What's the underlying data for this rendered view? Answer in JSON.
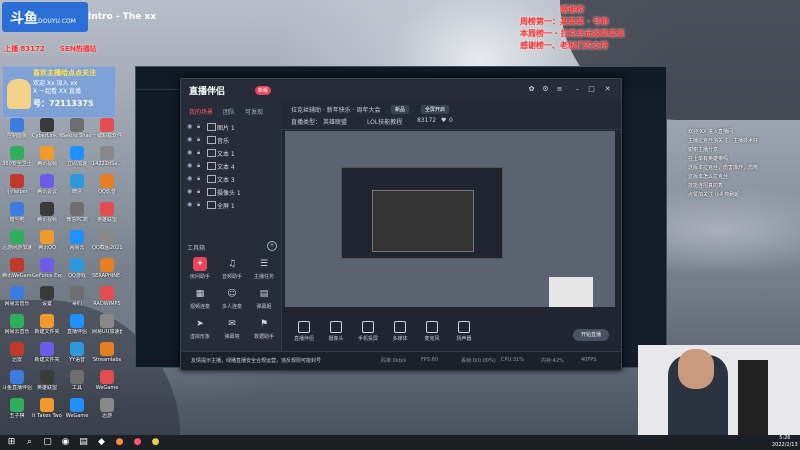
{
  "overlay": {
    "logo_text": "斗鱼",
    "logo_sub": "DOUYU.COM",
    "stream_title": "Intro - The xx",
    "live_badge": "开播中",
    "room_id": "上播 83172",
    "room_label": "SEN热播站",
    "follow_line1": "喜欢主播给点点关注",
    "follow_line2": "欢迎 Xx 加入 xx",
    "follow_line3": "X 一起看 XX 直播",
    "follow_line4": "号：72113375",
    "red_text_lines": [
      "感谢榜",
      "周榜第一：某某某 · 号称",
      "本周榜一 · 拉克丝玩家某某某",
      "感谢榜一、老板们的支持"
    ]
  },
  "desktop_icons": [
    "控制面板",
    "CyberLink YouCam 7",
    "Sekiro Shadows",
    "一键卸载软件",
    "360安全卫士",
    "腾讯视频",
    "立即加速",
    "14222dSe...",
    "小Helper",
    "腾讯会议",
    "微信",
    "QQ影音",
    "暗号吧",
    "腾讯视频",
    "微信PC端",
    "英雄联盟",
    "迅游网游加速器",
    "腾讯QQ",
    "网易云",
    "QQ截图20210216",
    "腾讯WeGame",
    "GeForce Experience",
    "QQ游戏",
    "SERAPHINE-Chalibr...",
    "网易云音乐",
    "设置",
    "哥们",
    "RADWIMPS",
    "网易云音乐",
    "新建文件夹",
    "直播伴侣",
    "网易UU加速器",
    "迅雷",
    "新建文件夹",
    "YY语音",
    "Streamlabs",
    "斗鱼直播伴侣",
    "英雄联盟",
    "工具",
    "WeGame",
    "五子棋",
    "It Takes Two",
    "WeGame",
    "迅游"
  ],
  "app": {
    "title": "直播伴侣",
    "version_badge": "新版",
    "sidebar_tabs": [
      "我的场景",
      "团队",
      "可发现"
    ],
    "scene_items": [
      "图片 1",
      "音乐",
      "文本 1",
      "文本 4",
      "文本 3",
      "摄像头 1",
      "全屏 1"
    ],
    "tools_heading": "工具箱",
    "tools_add": "+",
    "tools": [
      {
        "icon": "✦",
        "label": "房间助手"
      },
      {
        "icon": "♫",
        "label": "音频助手"
      },
      {
        "icon": "☰",
        "label": "主播任务"
      },
      {
        "icon": "▦",
        "label": "视频连麦"
      },
      {
        "icon": "☺",
        "label": "多人连麦"
      },
      {
        "icon": "▤",
        "label": "弹幕姬"
      },
      {
        "icon": "➤",
        "label": "虚拟形象"
      },
      {
        "icon": "✉",
        "label": "弹幕墙"
      },
      {
        "icon": "⚑",
        "label": "数据助手"
      }
    ],
    "info_line1": "拉克丝辅助 · 新年快乐 · 周年大会",
    "info_tag1": "新品",
    "info_tag2": "全屏开启",
    "info_line2_label": "直播类型：",
    "info_line2_value": "英雄联盟",
    "info_room": "LOL技能教程",
    "info_id": "83172",
    "info_likes": "0",
    "ctrl_items": [
      {
        "name": "直播伴侣"
      },
      {
        "name": "摄像头"
      },
      {
        "name": "手机投屏"
      },
      {
        "name": "多媒体"
      },
      {
        "name": "麦克风"
      },
      {
        "name": "扬声器"
      }
    ],
    "start_button": "开始直播",
    "notice": "友情提示主播，绿播直播安全合规运营，违反规则可能封号",
    "stats": [
      "码率:0kb/s",
      "FPS:60",
      "丢帧:0(0.00%)",
      "CPU:31%",
      "内存:42%",
      "40FPS"
    ]
  },
  "chat": [
    "欢迎 XX 进入直播间",
    "主播拉克丝加关注，主播技术好",
    "谢谢主播分享",
    "在上单有英雄带吗",
    "这版本拉克丝，伤害爆炸，恐怖",
    "这版本怎么拉克丝",
    "技能连招真的秀",
    "点赞加关注 小礼物刷起"
  ],
  "clock": {
    "time": "5:26",
    "date": "2022/2/13"
  },
  "colors": {
    "accent": "#ff5a6a",
    "overlay_red": "#ff2a2a",
    "app_bg": "#202530",
    "logo_blue": "#2b6fd6"
  }
}
